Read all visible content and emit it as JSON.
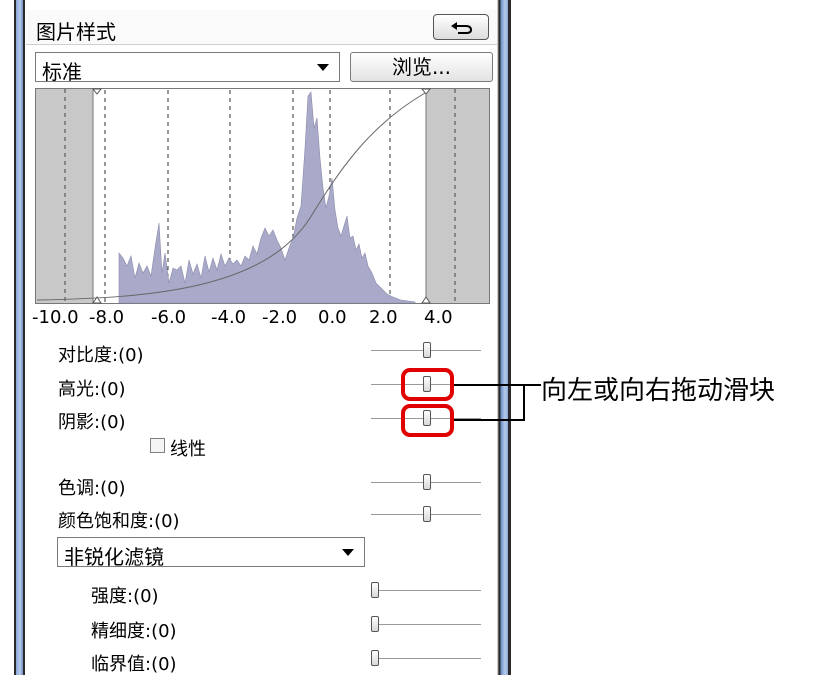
{
  "panel": {
    "title": "图片样式",
    "style_select": {
      "value": "标准"
    },
    "browse_label": "浏览...",
    "undo_icon": "undo-arrow-icon"
  },
  "histogram": {
    "tick_labels": [
      "-10.0",
      "-8.0",
      "-6.0",
      "-4.0",
      "-2.0",
      "0.0",
      "2.0",
      "4.0"
    ]
  },
  "adjustments": [
    {
      "label": "对比度:(0)",
      "value": 0,
      "highlighted": false
    },
    {
      "label": "高光:(0)",
      "value": 0,
      "highlighted": true
    },
    {
      "label": "阴影:(0)",
      "value": 0,
      "highlighted": true
    },
    {
      "label": "色调:(0)",
      "value": 0,
      "highlighted": false
    },
    {
      "label": "颜色饱和度:(0)",
      "value": 0,
      "highlighted": false
    }
  ],
  "linear_checkbox": {
    "label": "线性",
    "checked": false
  },
  "sharpen_select": {
    "value": "非锐化滤镜"
  },
  "sharpen": [
    {
      "label": "强度:(0)",
      "value": 0
    },
    {
      "label": "精细度:(0)",
      "value": 0
    },
    {
      "label": "临界值:(0)",
      "value": 0
    }
  ],
  "callout": "向左或向右拖动滑块",
  "colors": {
    "highlight": "#e00000",
    "histogram_fill": "#a9a9c9",
    "frame_blue": "#8aa8d8"
  }
}
